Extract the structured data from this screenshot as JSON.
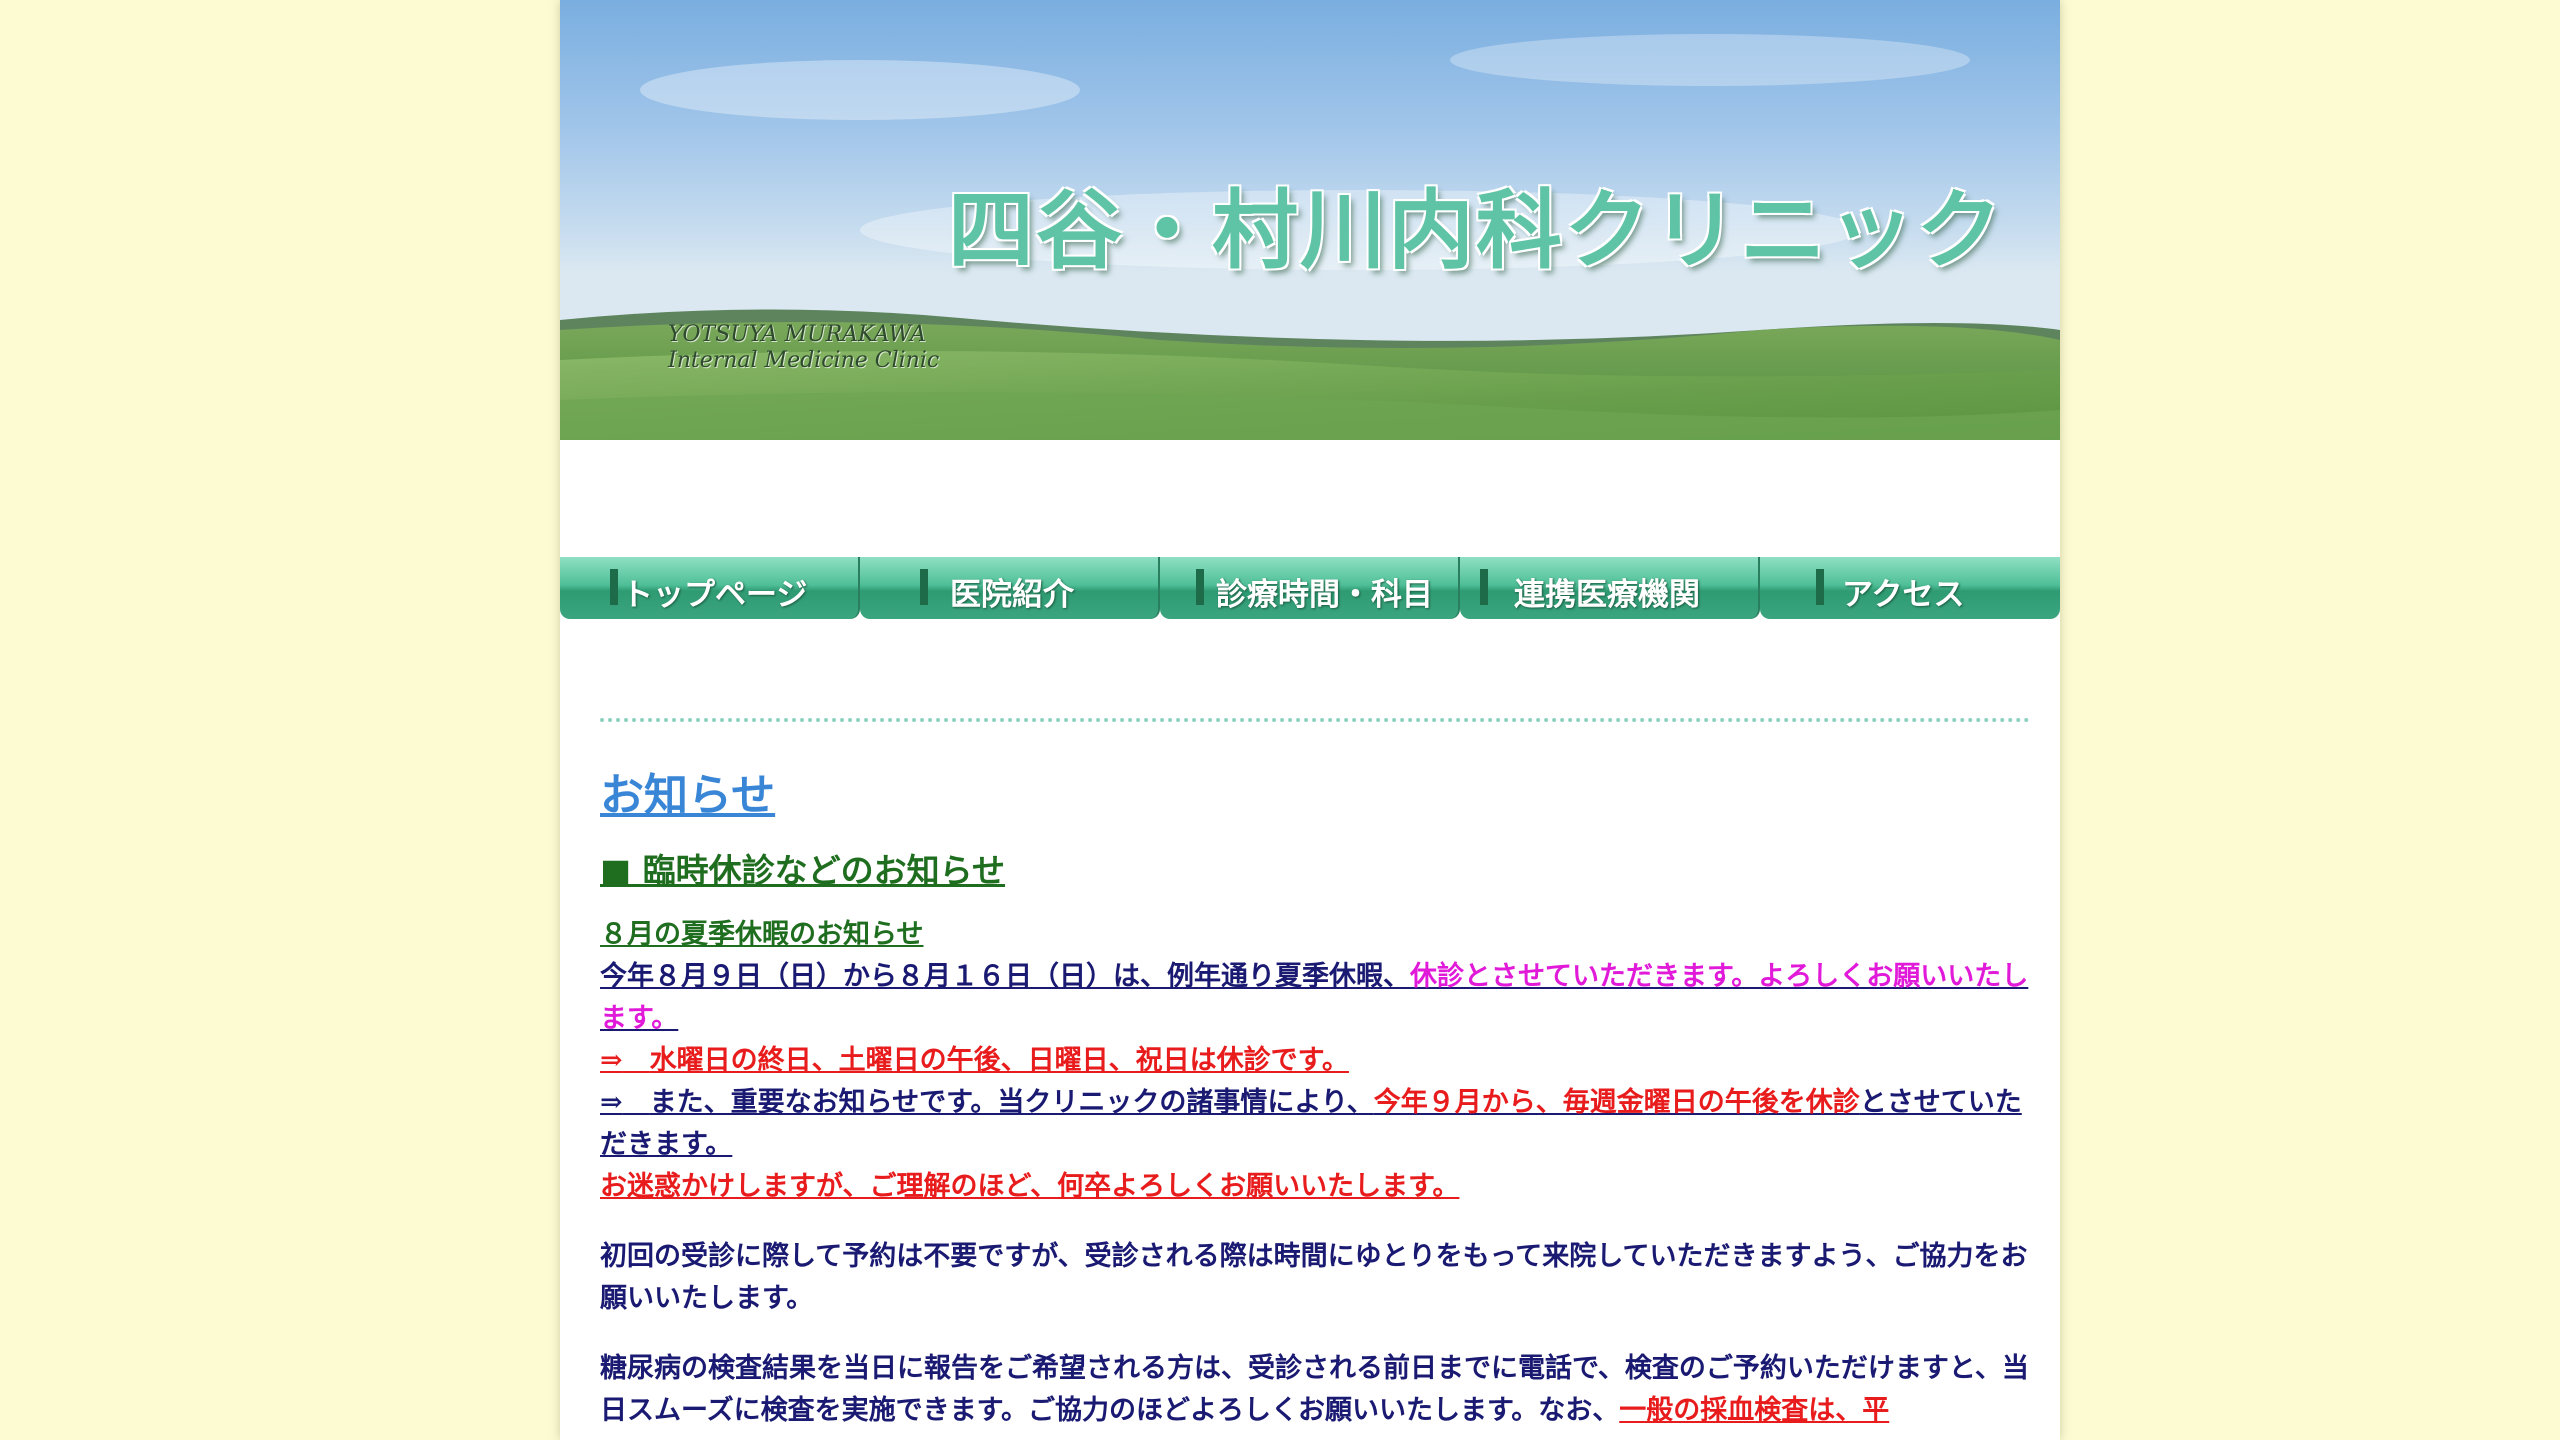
{
  "header": {
    "clinic_name": "四谷・村川内科クリニック",
    "clinic_name_en_line1": "YOTSUYA MURAKAWA",
    "clinic_name_en_line2": "Internal Medicine Clinic"
  },
  "nav": {
    "items": [
      {
        "label": "トップページ"
      },
      {
        "label": "医院紹介"
      },
      {
        "label": "診療時間・科目"
      },
      {
        "label": "連携医療機関"
      },
      {
        "label": "アクセス"
      }
    ]
  },
  "content": {
    "heading": "お知らせ",
    "subheading": "■ 臨時休診などのお知らせ",
    "summer_title": "８月の夏季休暇のお知らせ",
    "summer_text_a": "今年８月９日（日）から８月１６日（日）は、例年通り夏季休暇、",
    "summer_text_b": "休診とさせていただきます。よろしくお願いいたします。",
    "arrow": "⇒",
    "closed_days": "水曜日の終日、土曜日の午後、日曜日、祝日は休診です。",
    "important_a": "また、重要なお知らせです。当クリニックの諸事情により、",
    "important_b": "今年９月から、毎週金曜日の午後を休診",
    "important_c": "とさせていただきます。",
    "apology": "お迷惑かけしますが、ご理解のほど、何卒よろしくお願いいたします。",
    "first_visit": "初回の受診に際して予約は不要ですが、受診される際は時間にゆとりをもって来院していただきますよう、ご協力をお願いいたします。",
    "diabetes_a": "糖尿病の検査結果を当日に報告をご希望される方は、受診される前日までに電話で、検査のご予約いただけますと、当日スムーズに検査を実施できます。ご協力のほどよろしくお願いいたします。なお、",
    "diabetes_b": "一般の採血検査は、平"
  },
  "colors": {
    "page_background": "#fdfbd1",
    "heading_blue": "#3a86d6",
    "green": "#1f6e1f",
    "navy": "#1a1a73",
    "magenta": "#e01ad8",
    "red": "#e81c1c",
    "nav_green": "#4fbf98"
  }
}
